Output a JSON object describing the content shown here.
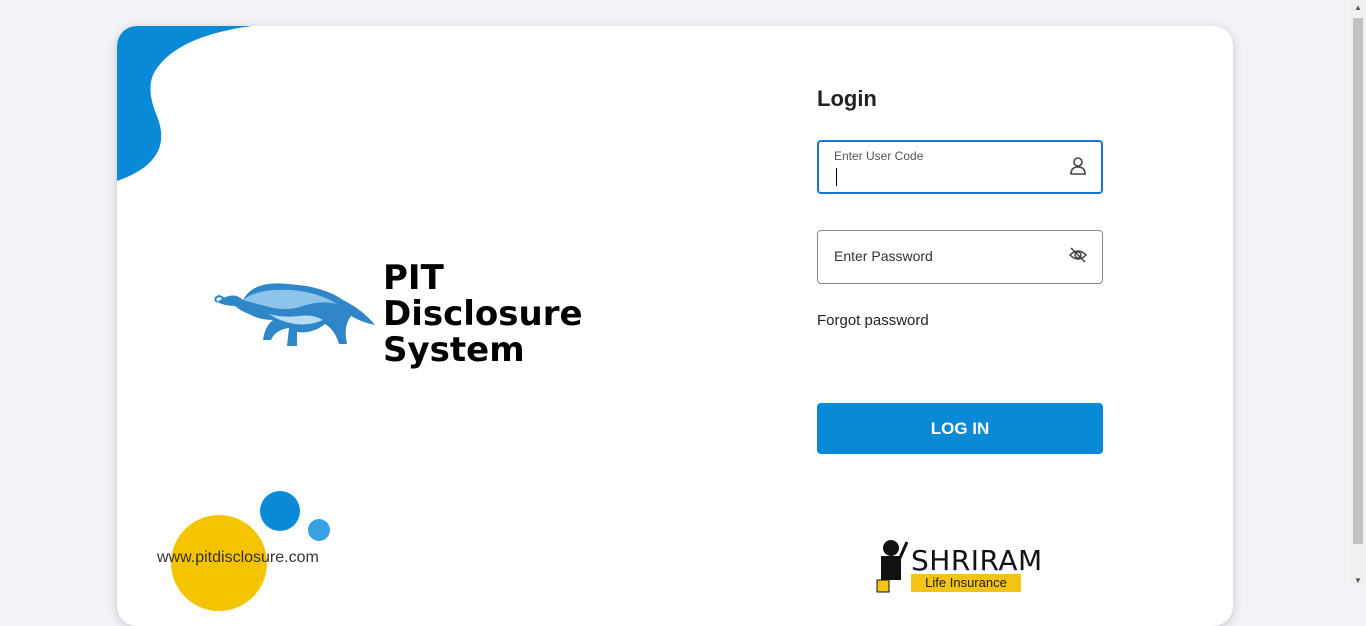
{
  "brand": {
    "title_line1": "PIT",
    "title_line2": "Disclosure",
    "title_line3": "System",
    "website": "www.pitdisclosure.com",
    "logo_icon": "bull-icon"
  },
  "login": {
    "heading": "Login",
    "user_code_label": "Enter User Code",
    "user_code_value": "",
    "password_placeholder": "Enter Password",
    "forgot_label": "Forgot password",
    "submit_label": "LOG IN",
    "user_icon": "user-icon",
    "password_icon": "eye-off-icon"
  },
  "partner": {
    "name": "SHRIRAM",
    "subtitle": "Life Insurance"
  },
  "colors": {
    "accent_blue": "#0a8ad6",
    "yellow": "#f5c400",
    "background": "#f1f3f6"
  }
}
